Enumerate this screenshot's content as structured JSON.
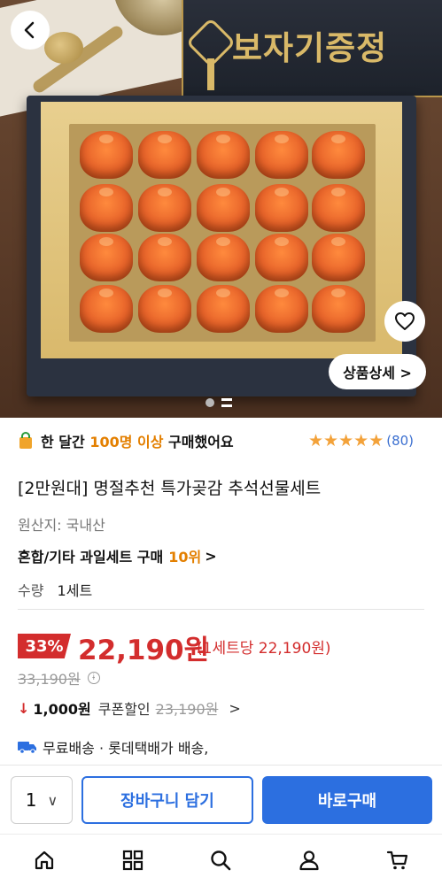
{
  "hero": {
    "banner_text": "보자기증정",
    "detail_button_label": "상품상세 >"
  },
  "buyers": {
    "prefix": "한 달간",
    "highlight": "100명 이상",
    "suffix": "구매했어요"
  },
  "rating": {
    "stars": 5,
    "review_count": "(80)"
  },
  "product": {
    "title": "[2만원대] 명절추천 특가곶감 추석선물세트",
    "origin": "원산지: 국내산",
    "rank_text": "혼합/기타 과일세트 구매",
    "rank_value": "10위",
    "rank_chevron": ">",
    "qty_label": "수량",
    "qty_value": "1세트"
  },
  "price": {
    "discount": "33%",
    "sale_price": "22,190원",
    "per_unit": "(1세트당 22,190원)",
    "original_price": "33,190원",
    "info_glyph": "i"
  },
  "coupon": {
    "arrow": "↓",
    "amount": "1,000원",
    "label": "쿠폰할인",
    "strike_price": "23,190원",
    "chevron": ">"
  },
  "shipping": {
    "text": "무료배송 · 롯데택배가 배송,"
  },
  "buy_bar": {
    "qty": "1",
    "qty_chevron": "∨",
    "cart_label": "장바구니 담기",
    "buy_label": "바로구매"
  },
  "colors": {
    "accent_blue": "#2c6fe0",
    "price_red": "#d32d2d",
    "highlight_orange": "#e37f00",
    "star": "#f3a23a"
  }
}
